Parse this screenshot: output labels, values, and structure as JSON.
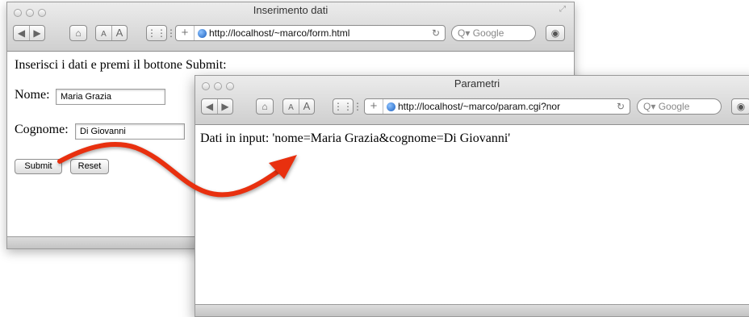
{
  "window1": {
    "title": "Inserimento dati",
    "url": "http://localhost/~marco/form.html",
    "search_placeholder": "Google",
    "text_size_small": "A",
    "text_size_large": "A",
    "content": {
      "instructions": "Inserisci i dati e premi il bottone Submit:",
      "nome_label": "Nome:",
      "nome_value": "Maria Grazia",
      "cognome_label": "Cognome:",
      "cognome_value": "Di Giovanni",
      "submit_label": "Submit",
      "reset_label": "Reset"
    }
  },
  "window2": {
    "title": "Parametri",
    "url": "http://localhost/~marco/param.cgi?nor",
    "search_placeholder": "Google",
    "text_size_small": "A",
    "text_size_large": "A",
    "content": {
      "output": "Dati in input: 'nome=Maria Grazia&cognome=Di Giovanni'"
    }
  },
  "icons": [
    "back-icon",
    "forward-icon",
    "home-icon",
    "grid-icon",
    "add-bookmark-icon",
    "globe-icon",
    "reload-icon",
    "search-icon",
    "downloads-icon",
    "resize-icon"
  ],
  "colors": {
    "arrow": "#e8300f"
  }
}
